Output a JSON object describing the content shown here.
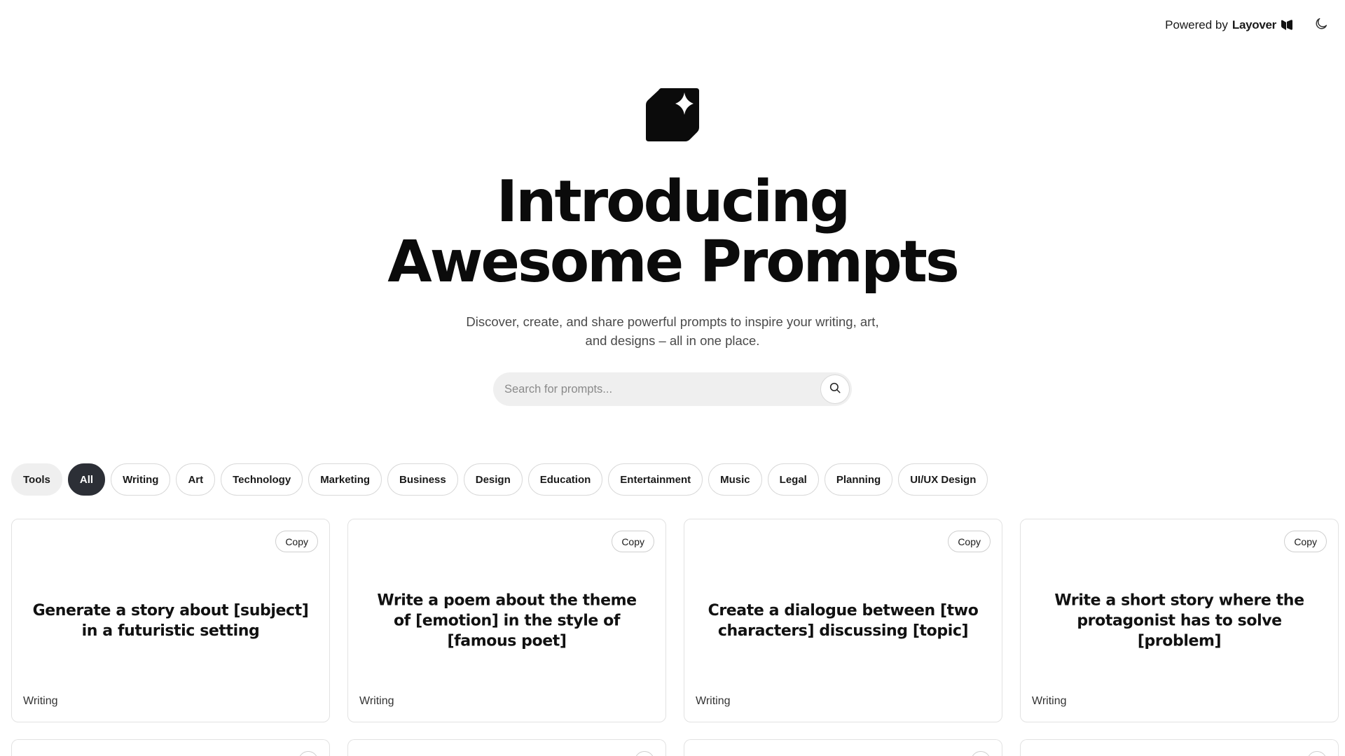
{
  "header": {
    "powered_by": "Powered by",
    "brand": "Layover"
  },
  "hero": {
    "title_line1": "Introducing",
    "title_line2": "Awesome Prompts",
    "subtitle": "Discover, create, and share powerful prompts to inspire your writing, art, and designs – all in one place."
  },
  "search": {
    "placeholder": "Search for prompts..."
  },
  "filters": {
    "tools_label": "Tools",
    "categories": [
      "All",
      "Writing",
      "Art",
      "Technology",
      "Marketing",
      "Business",
      "Design",
      "Education",
      "Entertainment",
      "Music",
      "Legal",
      "Planning",
      "UI/UX Design"
    ],
    "active": "All"
  },
  "cards": [
    {
      "copy_label": "Copy",
      "text": "Generate a story about [subject] in a futuristic setting",
      "category": "Writing"
    },
    {
      "copy_label": "Copy",
      "text": "Write a poem about the theme of [emotion] in the style of [famous poet]",
      "category": "Writing"
    },
    {
      "copy_label": "Copy",
      "text": "Create a dialogue between [two characters] discussing [topic]",
      "category": "Writing"
    },
    {
      "copy_label": "Copy",
      "text": "Write a short story where the protagonist has to solve [problem]",
      "category": "Writing"
    }
  ],
  "colors": {
    "accent_dark": "#2c2f36",
    "chip_border": "#d9d9d9",
    "search_bg": "#efefef"
  },
  "icons": {
    "logo": "sparkle-note-icon",
    "theme": "moon-icon",
    "search": "search-icon",
    "brand": "layover-logo-icon"
  }
}
